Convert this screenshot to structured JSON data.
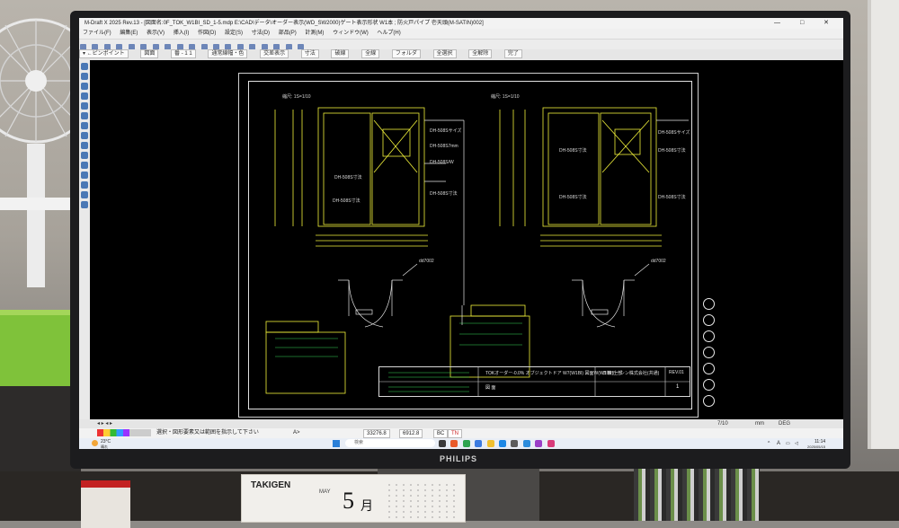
{
  "app": {
    "title": "M-Draft X 2025 Rev.13 - [図面名:0F_TOK_W1BI_SD_1-5.mdp E:\\CAD\\データ\\オーダー表示(WD_SW2000)ゲート表示形状 W1本 ; 防火戸パイプ 壱天頭(M-SATIN)002]",
    "window_controls": "— □ ✕"
  },
  "menu": [
    "ファイル(F)",
    "編集(E)",
    "表示(V)",
    "挿入(I)",
    "作図(D)",
    "設定(S)",
    "寸法(D)",
    "部品(P)",
    "計測(M)",
    "ウィンドウ(W)",
    "ヘルプ(H)"
  ],
  "toolbar2": {
    "field1": "▾ ←ピンポイント",
    "field2": "図面",
    "field3": "番 - 1 1",
    "field4": "通常線幅・色",
    "field5": "交差表示",
    "field6": "寸法",
    "field7": "破線",
    "field8": "全線",
    "field9": "フォルダ",
    "field10": "全選択",
    "field11": "全解除",
    "field12": "完了"
  },
  "drawing": {
    "scale_left": "縮尺: 1S=1/10",
    "scale_right": "縮尺: 1S=1/10",
    "door_code_left": "dd7002",
    "door_code_right": "dd7002",
    "left_labels": [
      "DH-508Sサイズ",
      "DH-508S7mm",
      "DH-508S/W",
      "DH-508S寸法",
      "DH-508S寸法",
      "DH-508S寸法"
    ],
    "right_labels": [
      "DH-508Sサイズ",
      "DH-508S寸法",
      "DH-508S寸法",
      "DH-508S寸法",
      "DH-508S寸法"
    ],
    "title_block": {
      "project": "TOKオーダー-0.0% オブジェクトドア W7(W1BI) 図面W(W1 BI)上部",
      "drawing_name": "図 面",
      "company": "日精テーシン株式会社(共通)",
      "rev": "REV.01",
      "sheet": "1"
    }
  },
  "status": {
    "page": "7/10",
    "unit": "mm",
    "angle_unit": "DEG",
    "coord_x": "33276.8",
    "coord_y": "6912.8",
    "prompt": "選択・図形要素又は範囲を指示して下さい",
    "prompt_prefix": "A>",
    "bc": "BC",
    "tn": "TN"
  },
  "taskbar": {
    "weather_temp": "23°C",
    "weather_desc": "晴れ",
    "search_placeholder": "検索",
    "time": "11:14",
    "date": "2025/05/15",
    "ime": "A"
  },
  "monitor": {
    "brand": "PHILIPS"
  },
  "desk": {
    "calendar_brand": "TAKIGEN",
    "calendar_month_num": "5",
    "calendar_month_suffix": "月",
    "calendar_month_en": "MAY"
  },
  "colors": {
    "drawing_yellow": "#f2f23a",
    "drawing_white": "#e6e6e6",
    "drawing_green": "#39d957",
    "canvas_bg": "#000000"
  }
}
